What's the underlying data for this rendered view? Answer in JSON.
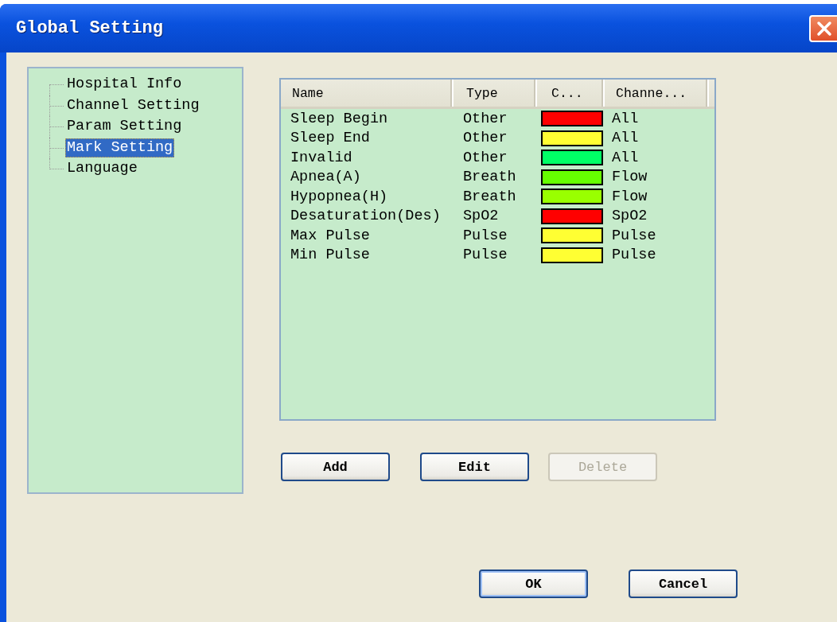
{
  "window": {
    "title": "Global Setting"
  },
  "tree": {
    "items": [
      {
        "label": "Hospital Info",
        "selected": false
      },
      {
        "label": "Channel Setting",
        "selected": false
      },
      {
        "label": "Param Setting",
        "selected": false
      },
      {
        "label": "Mark Setting",
        "selected": true
      },
      {
        "label": "Language",
        "selected": false
      }
    ]
  },
  "table": {
    "columns": [
      "Name",
      "Type",
      "C...",
      "Channe..."
    ],
    "rows": [
      {
        "name": "Sleep Begin",
        "type": "Other",
        "color": "#ff0000",
        "channel": "All"
      },
      {
        "name": "Sleep End",
        "type": "Other",
        "color": "#ffff33",
        "channel": "All"
      },
      {
        "name": "Invalid",
        "type": "Other",
        "color": "#00ff66",
        "channel": "All"
      },
      {
        "name": "Apnea(A)",
        "type": "Breath",
        "color": "#66ff00",
        "channel": "Flow"
      },
      {
        "name": "Hypopnea(H)",
        "type": "Breath",
        "color": "#99ff00",
        "channel": "Flow"
      },
      {
        "name": "Desaturation(Des)",
        "type": "SpO2",
        "color": "#ff0000",
        "channel": "SpO2"
      },
      {
        "name": "Max Pulse",
        "type": "Pulse",
        "color": "#ffff33",
        "channel": "Pulse"
      },
      {
        "name": "Min Pulse",
        "type": "Pulse",
        "color": "#ffff33",
        "channel": "Pulse"
      }
    ]
  },
  "list_buttons": [
    {
      "label": "Add",
      "disabled": false
    },
    {
      "label": "Edit",
      "disabled": false
    },
    {
      "label": "Delete",
      "disabled": true
    }
  ],
  "dialog_buttons": [
    {
      "label": "OK",
      "default": true
    },
    {
      "label": "Cancel",
      "default": false
    }
  ]
}
